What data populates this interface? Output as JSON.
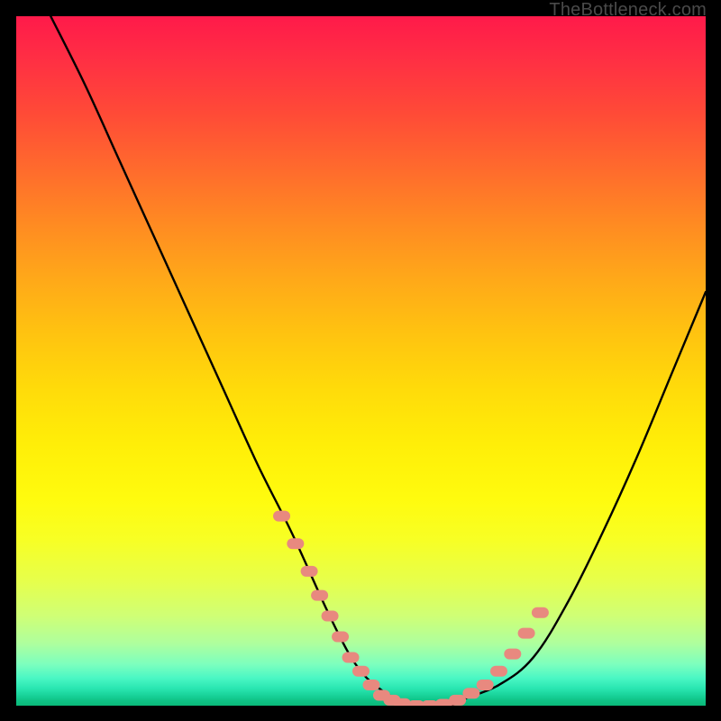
{
  "watermark": "TheBottleneck.com",
  "chart_data": {
    "type": "line",
    "title": "",
    "xlabel": "",
    "ylabel": "",
    "xlim": [
      0,
      100
    ],
    "ylim": [
      0,
      100
    ],
    "series": [
      {
        "name": "bottleneck-curve",
        "x": [
          5,
          10,
          15,
          20,
          25,
          30,
          35,
          40,
          45,
          48,
          50,
          52,
          55,
          58,
          60,
          63,
          65,
          70,
          75,
          80,
          85,
          90,
          95,
          100
        ],
        "values": [
          100,
          90,
          79,
          68,
          57,
          46,
          35,
          25,
          14,
          8,
          5,
          3,
          1,
          0,
          0,
          0,
          1,
          3,
          7,
          15,
          25,
          36,
          48,
          60
        ]
      }
    ],
    "markers": {
      "name": "highlight-dots",
      "color": "#E8897F",
      "x": [
        38.5,
        40.5,
        42.5,
        44.0,
        45.5,
        47.0,
        48.5,
        50.0,
        51.5,
        53.0,
        54.5,
        56.0,
        58.0,
        60.0,
        62.0,
        64.0,
        66.0,
        68.0,
        70.0,
        72.0,
        74.0,
        76.0
      ],
      "values": [
        27.5,
        23.5,
        19.5,
        16.0,
        13.0,
        10.0,
        7.0,
        5.0,
        3.0,
        1.5,
        0.8,
        0.3,
        0.0,
        0.0,
        0.2,
        0.8,
        1.8,
        3.0,
        5.0,
        7.5,
        10.5,
        13.5
      ]
    },
    "gradient_stops": [
      {
        "pos": 0.0,
        "color": "#FF1A4A"
      },
      {
        "pos": 0.5,
        "color": "#FFD60A"
      },
      {
        "pos": 0.8,
        "color": "#F0FF30"
      },
      {
        "pos": 0.95,
        "color": "#60FFB0"
      },
      {
        "pos": 1.0,
        "color": "#0AB878"
      }
    ]
  }
}
